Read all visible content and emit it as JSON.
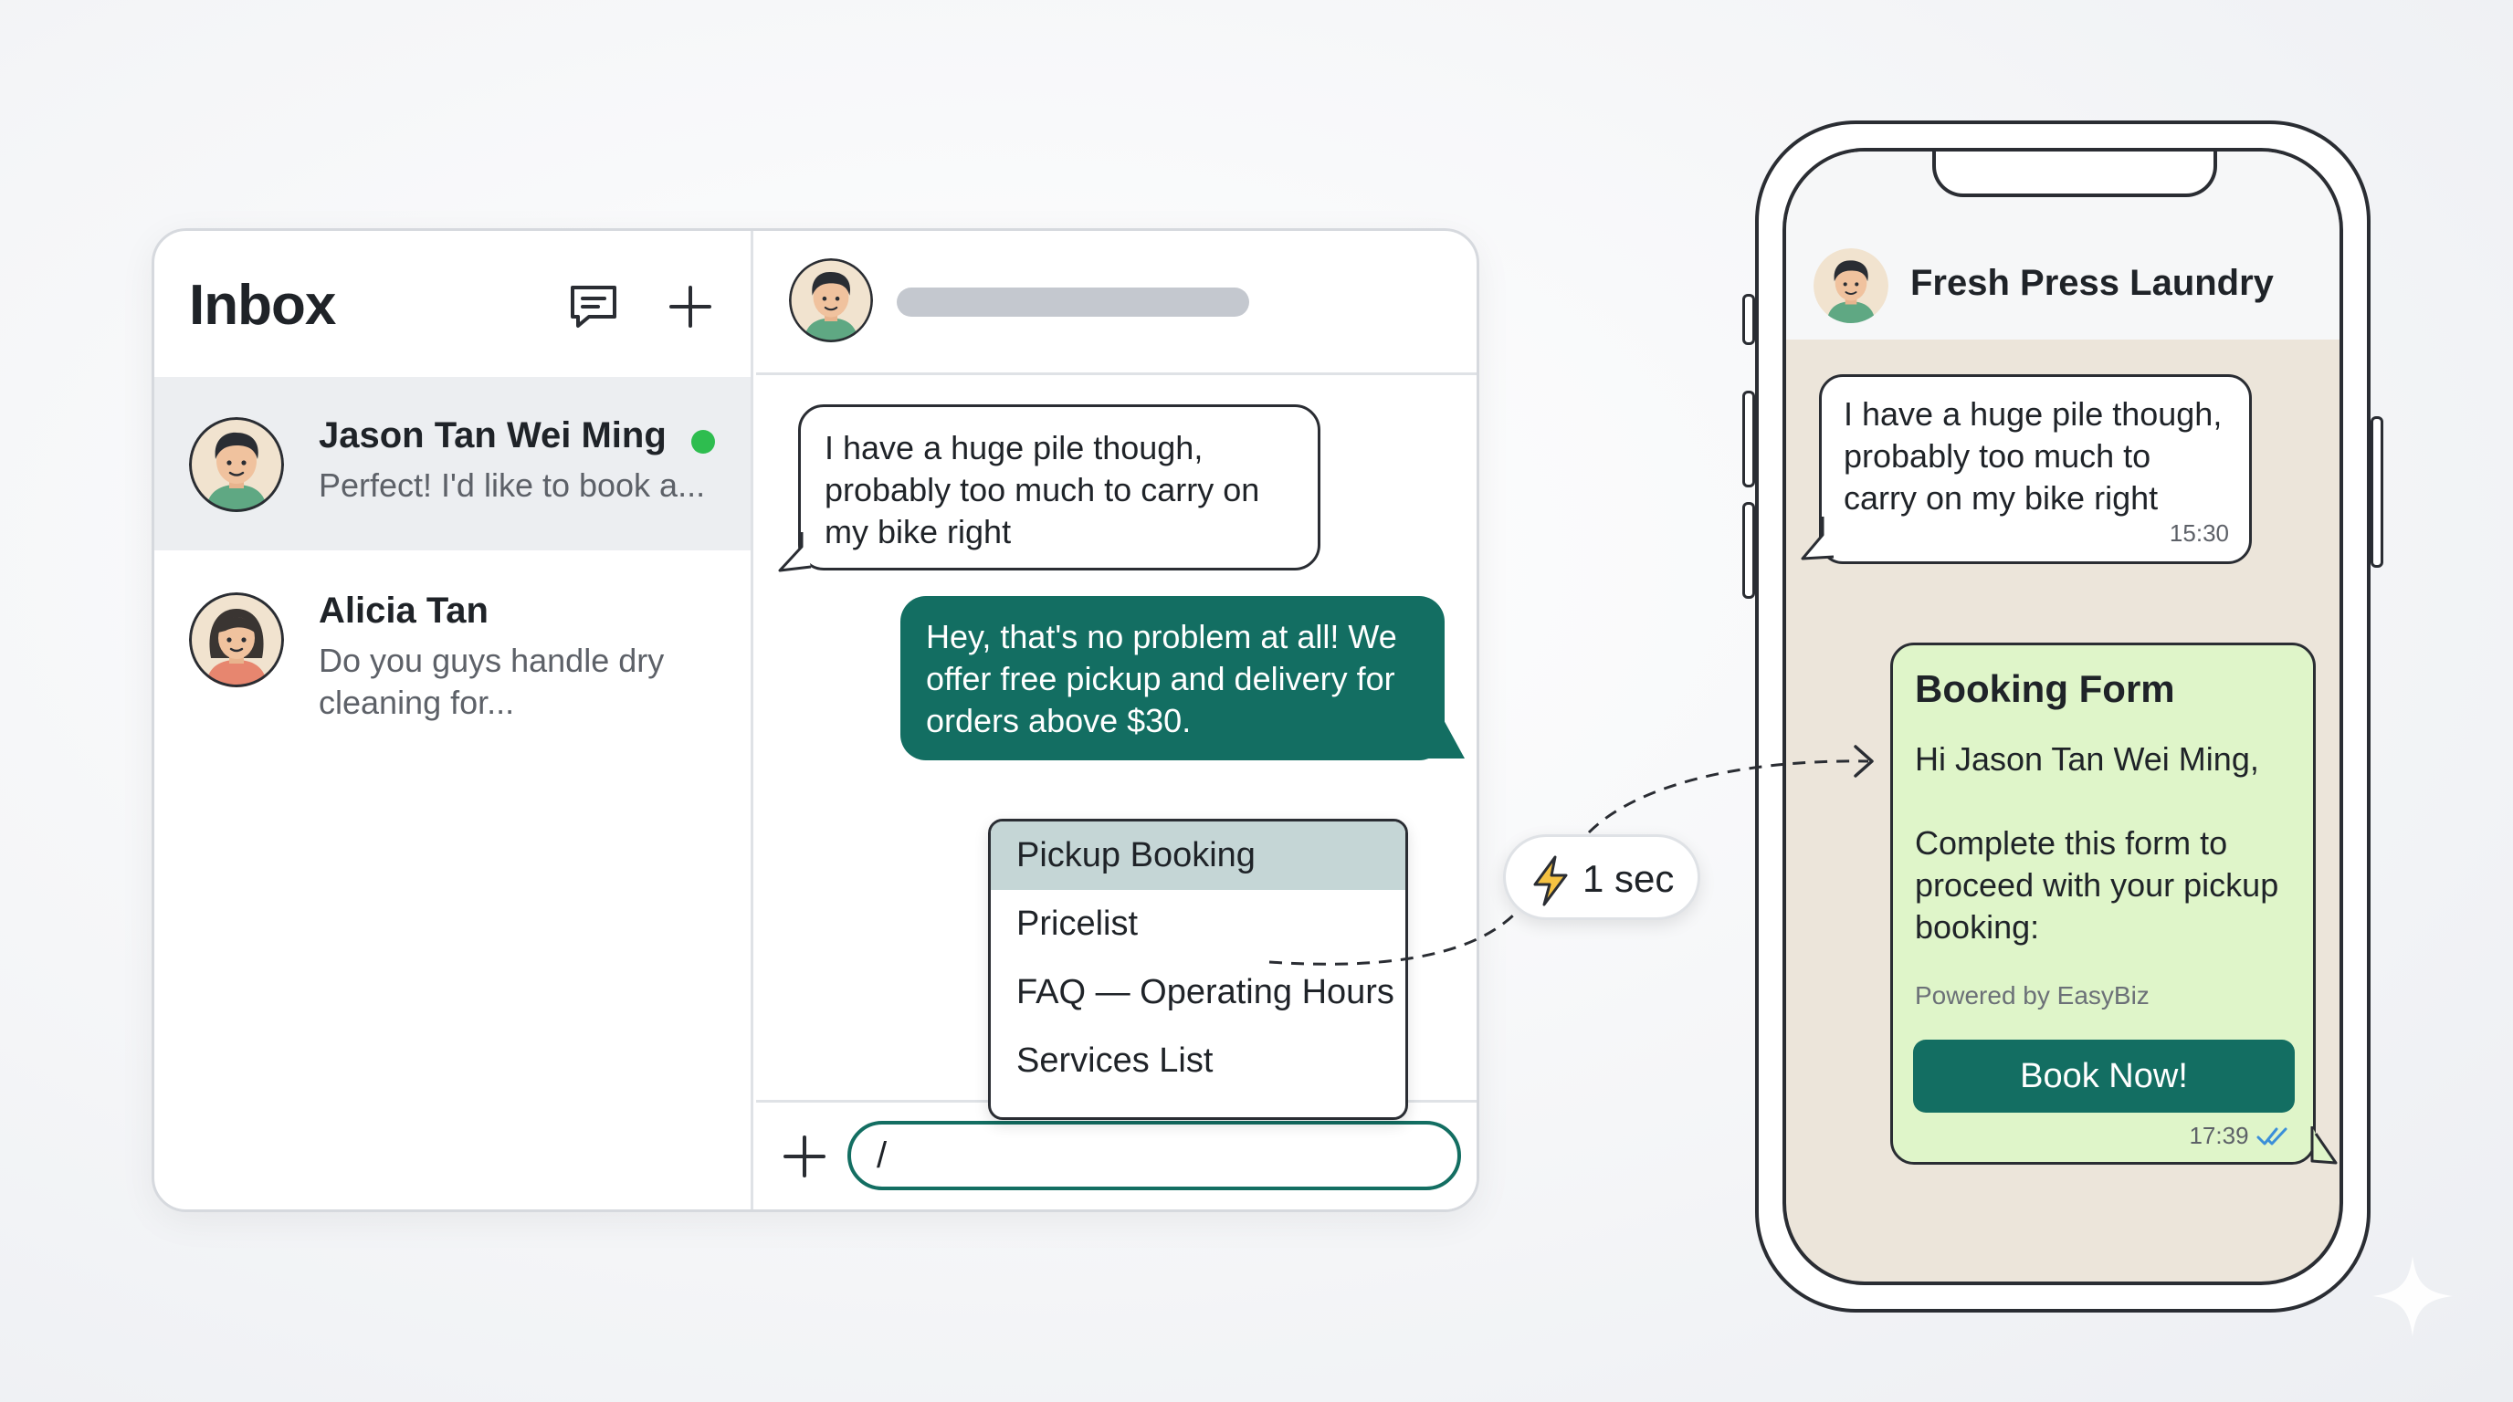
{
  "inbox": {
    "title": "Inbox",
    "icons": {
      "compose": "chat-compose-icon",
      "new": "plus-icon"
    },
    "conversations": [
      {
        "name": "Jason Tan Wei Ming",
        "preview": "Perfect! I'd like to book a...",
        "online": true,
        "active": true
      },
      {
        "name": "Alicia Tan",
        "preview": "Do you guys handle dry cleaning for...",
        "online": false,
        "active": false
      }
    ]
  },
  "chat": {
    "incoming": "I have a huge pile though, probably too much to carry on my bike right",
    "outgoing": "Hey, that's no problem at all! We offer free pickup and delivery for orders above $30.",
    "quick_replies": [
      "Pickup Booking",
      "Pricelist",
      "FAQ — Operating Hours",
      "Services List"
    ],
    "selected_quick_reply": "Pickup Booking",
    "composer_value": "/"
  },
  "speed_badge": {
    "icon": "lightning-icon",
    "text": "1 sec"
  },
  "phone": {
    "contact_name": "Fresh Press Laundry",
    "incoming": "I have a huge pile though, probably too much to carry on my bike right",
    "incoming_time": "15:30",
    "form": {
      "title": "Booking Form",
      "greeting": "Hi Jason Tan Wei Ming,",
      "body": "Complete this form to proceed with your pickup booking:",
      "powered_by": "Powered by EasyBiz",
      "button_label": "Book Now!",
      "time": "17:39",
      "status_icon": "double-check-icon"
    }
  },
  "colors": {
    "brand_teal": "#136e62",
    "online_green": "#2ebd4f",
    "form_bg": "#dff5c9",
    "phone_chat_bg": "#ece5da",
    "selected_row": "#c5d6d6"
  }
}
